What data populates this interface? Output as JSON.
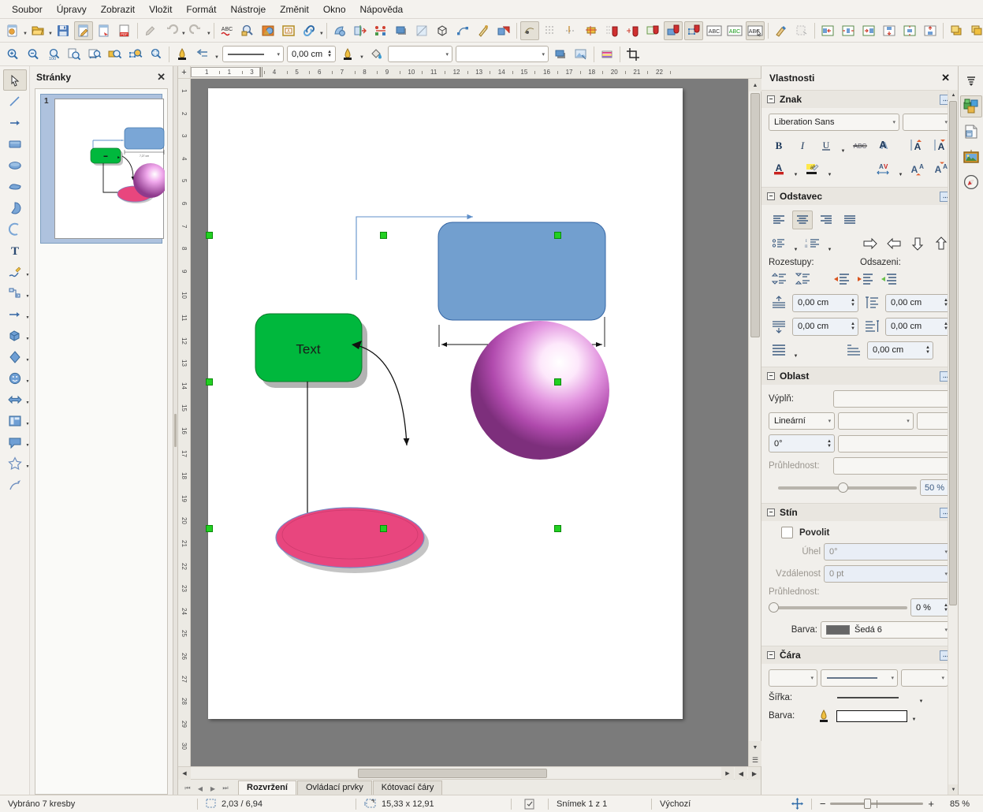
{
  "app": {
    "title": "LibreOffice Draw"
  },
  "menubar": {
    "items": [
      {
        "label": "Soubor"
      },
      {
        "label": "Úpravy"
      },
      {
        "label": "Zobrazit"
      },
      {
        "label": "Vložit"
      },
      {
        "label": "Formát"
      },
      {
        "label": "Nástroje"
      },
      {
        "label": "Změnit"
      },
      {
        "label": "Okno"
      },
      {
        "label": "Nápověda"
      }
    ]
  },
  "standard_toolbar": {
    "overflow_label": "»",
    "items": [
      {
        "name": "new-document",
        "icon": "new-doc-icon",
        "dropdown": true
      },
      {
        "name": "open-document",
        "icon": "open-folder-icon",
        "dropdown": true
      },
      {
        "name": "save-document",
        "icon": "floppy-save-icon"
      },
      {
        "name": "edit-mode",
        "icon": "edit-pencil-icon",
        "active": true
      },
      {
        "name": "export-direct",
        "icon": "export-icon"
      },
      {
        "name": "export-pdf",
        "icon": "pdf-icon"
      },
      {
        "name": "print-preview",
        "icon": "print-preview-icon"
      },
      {
        "name": "undo",
        "icon": "undo-arrow-icon",
        "dropdown": true
      },
      {
        "name": "redo",
        "icon": "redo-arrow-icon",
        "dropdown": true
      },
      {
        "name": "spelling",
        "icon": "abc-spellcheck-icon"
      },
      {
        "name": "find-replace",
        "icon": "magnifier-icon"
      },
      {
        "name": "gallery",
        "icon": "gallery-icon"
      },
      {
        "name": "display-views",
        "icon": "display-views-icon"
      },
      {
        "name": "hyperlink",
        "icon": "chain-link-icon",
        "dropdown": true
      },
      {
        "name": "rotate",
        "icon": "rotate-shape-icon"
      },
      {
        "name": "transformations",
        "icon": "transform-icon"
      },
      {
        "name": "align-objects",
        "icon": "align-objects-icon"
      },
      {
        "name": "shadow",
        "icon": "shadow-square-icon"
      },
      {
        "name": "crop-image",
        "icon": "crop-image-icon"
      },
      {
        "name": "toggle-extrusion",
        "icon": "cube-extrusion-icon"
      },
      {
        "name": "edit-points",
        "icon": "edit-points-icon"
      },
      {
        "name": "glue-points",
        "icon": "glue-point-icon"
      },
      {
        "name": "toggle-3d",
        "icon": "3d-objects-icon"
      },
      {
        "name": "display-grid",
        "icon": "grid-snap-icon",
        "active": true
      },
      {
        "name": "grid-visible",
        "icon": "grid-dots-icon"
      },
      {
        "name": "helplines-while-moving",
        "icon": "helplines-icon"
      },
      {
        "name": "snap-to-grid",
        "icon": "snap-grid-icon"
      },
      {
        "name": "snap-guides",
        "icon": "snap-guides-magnet-icon"
      },
      {
        "name": "snap-page-margins",
        "icon": "snap-margins-icon"
      },
      {
        "name": "snap-object-frame",
        "icon": "snap-frame-icon"
      },
      {
        "name": "snap-object-points",
        "icon": "snap-points-icon"
      },
      {
        "name": "text-box",
        "icon": "abc-textbox-icon"
      },
      {
        "name": "insert-text-box",
        "icon": "abc-green-icon"
      },
      {
        "name": "text-attributes",
        "icon": "abc-cursor-icon"
      },
      {
        "name": "clone-formatting",
        "icon": "paintbrush-icon"
      },
      {
        "name": "clear-formatting",
        "icon": "clear-format-icon"
      },
      {
        "name": "align-left",
        "icon": "align-left-icon"
      },
      {
        "name": "align-center",
        "icon": "align-center-icon"
      },
      {
        "name": "align-right",
        "icon": "align-right-icon"
      },
      {
        "name": "align-top",
        "icon": "align-top-icon"
      },
      {
        "name": "align-middle",
        "icon": "align-middle-icon"
      },
      {
        "name": "align-bottom",
        "icon": "align-bottom-icon"
      },
      {
        "name": "bring-forward",
        "icon": "bring-forward-icon"
      },
      {
        "name": "send-backward",
        "icon": "send-backward-icon"
      }
    ]
  },
  "line_toolbar": {
    "zoom_items": [
      {
        "name": "zoom-in",
        "icon": "zoom-in-icon"
      },
      {
        "name": "zoom-out",
        "icon": "zoom-out-icon"
      },
      {
        "name": "zoom-100",
        "icon": "zoom-100-icon"
      },
      {
        "name": "zoom-page",
        "icon": "zoom-page-icon"
      },
      {
        "name": "zoom-page-width",
        "icon": "zoom-width-icon"
      },
      {
        "name": "zoom-previous",
        "icon": "zoom-previous-icon"
      },
      {
        "name": "zoom-object",
        "icon": "zoom-object-icon"
      },
      {
        "name": "zoom-shift",
        "icon": "zoom-shift-icon"
      }
    ],
    "line_style_value": "",
    "line_width_value": "0,00 cm",
    "area_style_value": "",
    "area_fill_value": "",
    "items": [
      {
        "name": "line-color",
        "icon": "line-color-icon",
        "dropdown": true
      },
      {
        "name": "arrow-style",
        "icon": "arrow-style-icon",
        "dropdown": true
      },
      {
        "name": "fill-color",
        "icon": "fill-color-bucket-icon",
        "dropdown": true
      },
      {
        "name": "area-style-button",
        "icon": "area-style-icon"
      },
      {
        "name": "shadow-toggle",
        "icon": "shadow-toggle-icon"
      },
      {
        "name": "filter-image",
        "icon": "image-filter-icon"
      },
      {
        "name": "points-toolbar",
        "icon": "points-color-icon"
      },
      {
        "name": "crop",
        "icon": "crop-icon"
      }
    ]
  },
  "tools_sidebar": {
    "items": [
      {
        "name": "select-tool",
        "icon": "cursor-arrow-icon",
        "active": true
      },
      {
        "name": "line-tool",
        "icon": "line-icon"
      },
      {
        "name": "line-arrow-tool",
        "icon": "arrow-line-icon"
      },
      {
        "name": "rectangle-tool",
        "icon": "rectangle-icon"
      },
      {
        "name": "ellipse-tool",
        "icon": "ellipse-icon"
      },
      {
        "name": "freeform-tool",
        "icon": "freeform-shape-icon"
      },
      {
        "name": "pie-tool",
        "icon": "pie-shape-icon"
      },
      {
        "name": "arc-tool",
        "icon": "arc-icon"
      },
      {
        "name": "text-tool",
        "icon": "text-t-icon"
      },
      {
        "name": "curve-tool",
        "icon": "curve-pencil-icon",
        "dropdown": true
      },
      {
        "name": "connector-tool",
        "icon": "connector-icon",
        "dropdown": true
      },
      {
        "name": "lines-arrows-tool",
        "icon": "lines-arrows-icon",
        "dropdown": true
      },
      {
        "name": "3d-objects-tool",
        "icon": "cube-3d-icon",
        "dropdown": true
      },
      {
        "name": "basic-shapes-tool",
        "icon": "diamond-shape-icon",
        "dropdown": true
      },
      {
        "name": "symbol-shapes-tool",
        "icon": "smiley-icon",
        "dropdown": true
      },
      {
        "name": "block-arrows-tool",
        "icon": "block-arrow-icon",
        "dropdown": true
      },
      {
        "name": "flowchart-tool",
        "icon": "flowchart-icon",
        "dropdown": true
      },
      {
        "name": "callout-tool",
        "icon": "callout-bubble-icon",
        "dropdown": true
      },
      {
        "name": "stars-tool",
        "icon": "star-icon",
        "dropdown": true
      },
      {
        "name": "points-tool",
        "icon": "edit-points-tool-icon"
      }
    ]
  },
  "pages_panel": {
    "title": "Stránky",
    "close_label": "✕",
    "slides": [
      {
        "number": "1",
        "selected": true
      }
    ]
  },
  "ruler": {
    "unit": "cm",
    "h_labels": [
      "1",
      "1",
      "3",
      "4",
      "5",
      "6",
      "7",
      "8",
      "9",
      "10",
      "11",
      "12",
      "13",
      "14",
      "15",
      "16",
      "17",
      "18",
      "20",
      "21",
      "22"
    ],
    "v_labels": [
      "1",
      "2",
      "3",
      "4",
      "5",
      "6",
      "7",
      "8",
      "9",
      "10",
      "11",
      "12",
      "13",
      "14",
      "15",
      "16",
      "17",
      "18",
      "19",
      "20",
      "21",
      "22",
      "23",
      "24",
      "25",
      "26",
      "27",
      "28",
      "29",
      "30"
    ]
  },
  "canvas": {
    "dimension_label": "7,27 cm",
    "green_shape_text": "Text",
    "colors": {
      "blue_rect_fill": "#729fcf",
      "green_rect_fill": "#00b83d",
      "pink_ellipse_fill": "#e8467e",
      "sphere_fill": "#b34bb0",
      "handle_color": "#22d022"
    }
  },
  "layer_tabs": {
    "nav": [
      "⏮",
      "◀",
      "▶",
      "⏭"
    ],
    "tabs": [
      {
        "label": "Rozvržení",
        "selected": true
      },
      {
        "label": "Ovládací prvky",
        "selected": false
      },
      {
        "label": "Kótovací čáry",
        "selected": false
      }
    ]
  },
  "properties": {
    "title": "Vlastnosti",
    "close_label": "✕",
    "character": {
      "title": "Znak",
      "font_name": "Liberation Sans",
      "font_size": "",
      "buttons": [
        {
          "name": "bold-button",
          "label": "B"
        },
        {
          "name": "italic-button",
          "label": "I"
        },
        {
          "name": "underline-button",
          "label": "U"
        },
        {
          "name": "strikethrough-button",
          "label": "ABC"
        },
        {
          "name": "shadow-text-button",
          "label": "A"
        },
        {
          "name": "increase-font-size-button",
          "label": "A↑"
        },
        {
          "name": "decrease-font-size-button",
          "label": "A↓"
        },
        {
          "name": "font-color-button",
          "label": "A"
        },
        {
          "name": "highlight-color-button",
          "label": "ab"
        },
        {
          "name": "character-spacing-button",
          "label": "AV"
        },
        {
          "name": "superscript-button",
          "label": "A²"
        },
        {
          "name": "subscript-button",
          "label": "A₂"
        }
      ]
    },
    "paragraph": {
      "title": "Odstavec",
      "align_buttons": [
        {
          "name": "align-left-button",
          "selected": false
        },
        {
          "name": "align-center-button",
          "selected": true
        },
        {
          "name": "align-right-button",
          "selected": false
        },
        {
          "name": "align-justified-button",
          "selected": false
        }
      ],
      "list_buttons": [
        {
          "name": "unordered-list-button"
        },
        {
          "name": "ordered-list-button"
        }
      ],
      "move_buttons": [
        {
          "name": "demote-button"
        },
        {
          "name": "promote-button"
        },
        {
          "name": "move-down-button"
        },
        {
          "name": "move-up-button"
        }
      ],
      "spacing_label": "Rozestupy:",
      "indent_label": "Odsazeni:",
      "space_above_value": "0,00 cm",
      "space_below_value": "0,00 cm",
      "indent_before_value": "0,00 cm",
      "indent_after_value": "0,00 cm",
      "first_line_indent_value": "0,00 cm"
    },
    "area": {
      "title": "Oblast",
      "fill_label": "Výplň:",
      "fill_value": "",
      "gradient_type": "Lineární",
      "gradient_preset": "",
      "gradient_extra": "",
      "angle_value": "0°",
      "angle_extra": "",
      "transparency_label": "Průhlednost:",
      "transparency_mode": "",
      "transparency_value": "50 %",
      "transparency_percent": 50
    },
    "shadow": {
      "title": "Stín",
      "enable_label": "Povolit",
      "enabled": false,
      "angle_label": "Úhel",
      "angle_value": "0°",
      "distance_label": "Vzdálenost",
      "distance_value": "0 pt",
      "transparency_label": "Průhlednost:",
      "transparency_value": "0 %",
      "transparency_percent": 0,
      "color_label": "Barva:",
      "color_value": "Šedá 6",
      "color_hex": "#666666"
    },
    "line": {
      "title": "Čára",
      "arrow_start": "",
      "line_style": "",
      "arrow_end": "",
      "width_label": "Šířka:",
      "color_label": "Barva:",
      "color_hex": "#ffffff"
    }
  },
  "deckbar": {
    "items": [
      {
        "name": "sidebar-settings-icon"
      },
      {
        "name": "properties-deck-icon",
        "selected": true
      },
      {
        "name": "page-deck-icon"
      },
      {
        "name": "gallery-deck-icon"
      },
      {
        "name": "navigator-deck-icon"
      }
    ]
  },
  "statusbar": {
    "selection_info": "Vybráno 7 kresby",
    "cursor_position": "2,03 / 6,94",
    "object_size": "15,33 x 12,91",
    "slide_info": "Snímek 1 z 1",
    "master_page": "Výchozí",
    "zoom_value": "85 %",
    "zoom_percent": 85,
    "zoom_minus": "−",
    "zoom_plus": "+"
  }
}
